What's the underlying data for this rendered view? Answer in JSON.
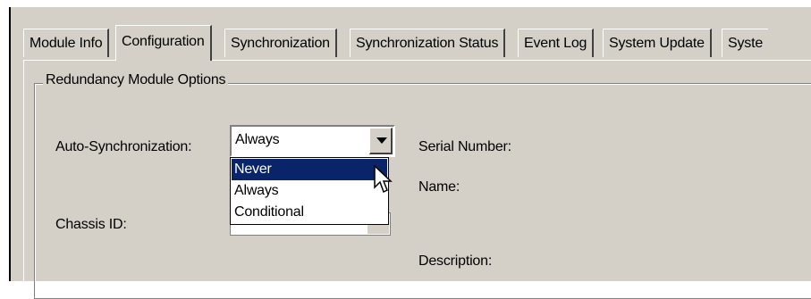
{
  "tabs": [
    {
      "label": "Module Info",
      "active": false
    },
    {
      "label": "Configuration",
      "active": true
    },
    {
      "label": "Synchronization",
      "active": false
    },
    {
      "label": "Synchronization Status",
      "active": false
    },
    {
      "label": "Event Log",
      "active": false
    },
    {
      "label": "System Update",
      "active": false
    },
    {
      "label": "Syste",
      "active": false
    }
  ],
  "group": {
    "title": "Redundancy Module Options"
  },
  "fields": {
    "auto_sync_label": "Auto-Synchronization:",
    "auto_sync_value": "Always",
    "chassis_id_label": "Chassis ID:",
    "serial_number_label": "Serial Number:",
    "name_label": "Name:",
    "description_label": "Description:"
  },
  "dropdown_options": [
    {
      "label": "Never",
      "highlighted": true
    },
    {
      "label": "Always",
      "highlighted": false
    },
    {
      "label": "Conditional",
      "highlighted": false
    }
  ],
  "colors": {
    "dialog_bg": "#d4d0c8",
    "highlight": "#0a246a"
  }
}
